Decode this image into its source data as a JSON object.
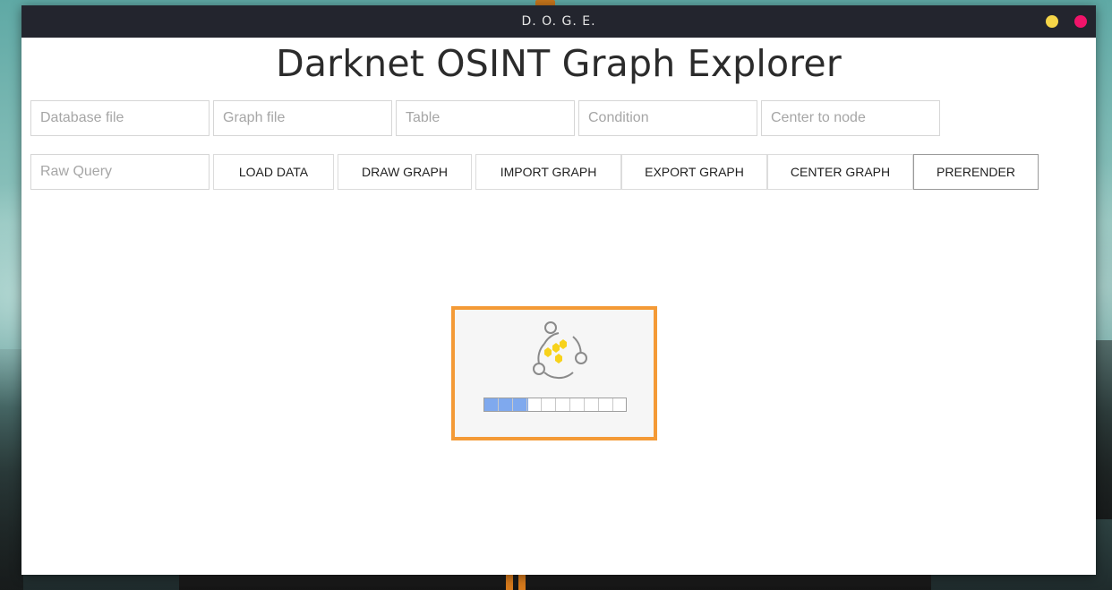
{
  "window": {
    "title": "D. O. G. E."
  },
  "app": {
    "heading": "Darknet OSINT Graph Explorer"
  },
  "inputs": {
    "database_file": {
      "placeholder": "Database file",
      "value": ""
    },
    "graph_file": {
      "placeholder": "Graph file",
      "value": ""
    },
    "table": {
      "placeholder": "Table",
      "value": ""
    },
    "condition": {
      "placeholder": "Condition",
      "value": ""
    },
    "center_to_node": {
      "placeholder": "Center to node",
      "value": ""
    },
    "raw_query": {
      "placeholder": "Raw Query",
      "value": ""
    }
  },
  "toolbar": {
    "load_data": "LOAD DATA",
    "draw_graph": "DRAW GRAPH",
    "import_graph": "IMPORT GRAPH",
    "export_graph": "EXPORT GRAPH",
    "center_graph": "CENTER GRAPH",
    "prerender": "PRERENDER"
  },
  "loader": {
    "icon": "graph-network-icon",
    "progress_fraction": 0.31,
    "accent_color": "#f49a36",
    "fill_color": "#7fa9ee"
  },
  "colors": {
    "titlebar": "#23252e",
    "minimize": "#f5d548",
    "close": "#f0146a"
  }
}
